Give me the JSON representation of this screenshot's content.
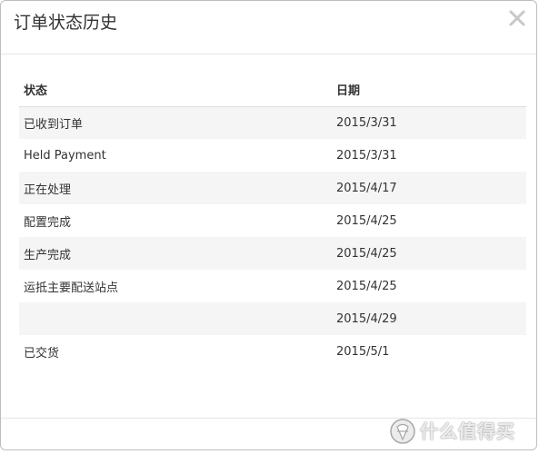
{
  "dialog": {
    "title": "订单状态历史",
    "close_icon": "close-icon"
  },
  "table": {
    "headers": {
      "status": "状态",
      "date": "日期"
    },
    "rows": [
      {
        "status": "已收到订单",
        "date": "2015/3/31"
      },
      {
        "status": "Held Payment",
        "date": "2015/3/31"
      },
      {
        "status": "正在处理",
        "date": "2015/4/17"
      },
      {
        "status": "配置完成",
        "date": "2015/4/25"
      },
      {
        "status": "生产完成",
        "date": "2015/4/25"
      },
      {
        "status": "运抵主要配送站点",
        "date": "2015/4/25"
      },
      {
        "status": "",
        "date": "2015/4/29"
      },
      {
        "status": "已交货",
        "date": "2015/5/1"
      }
    ]
  },
  "watermark": {
    "text": "什么值得买",
    "logo_icon": "smzdm-logo-icon"
  },
  "colors": {
    "row_stripe": "#f5f5f5",
    "border": "#bdbdbd",
    "divider": "#e5e5e5"
  }
}
